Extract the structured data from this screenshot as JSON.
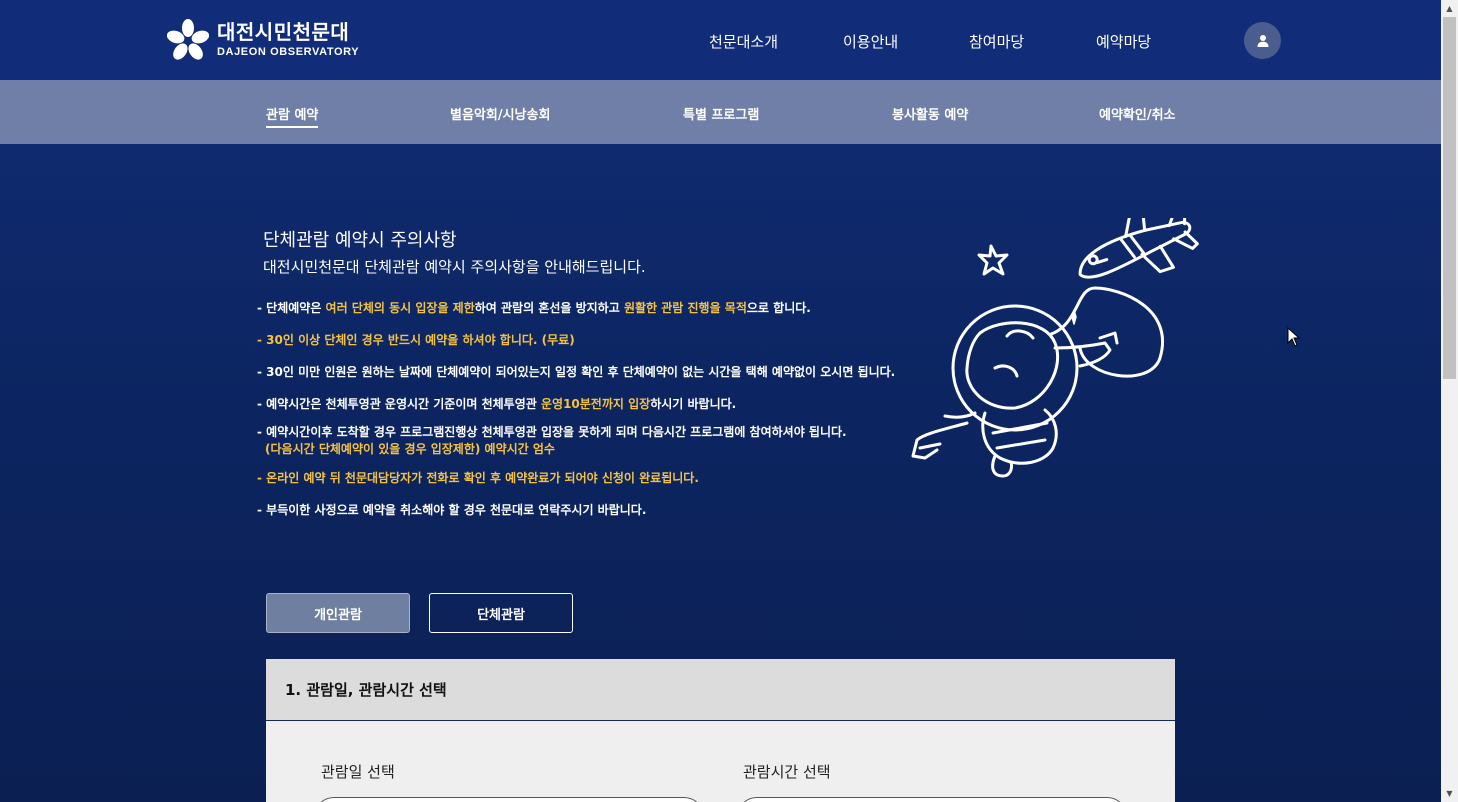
{
  "header": {
    "logo_ko": "대전시민천문대",
    "logo_en": "DAJEON OBSERVATORY",
    "nav": [
      "천문대소개",
      "이용안내",
      "참여마당",
      "예약마당"
    ]
  },
  "subnav": {
    "items": [
      "관람 예약",
      "별음악회/시낭송회",
      "특별 프로그램",
      "봉사활동 예약",
      "예약확인/취소"
    ]
  },
  "notice": {
    "title": "단체관람 예약시 주의사항",
    "subtitle": "대전시민천문대 단체관람 예약시 주의사항을 안내해드립니다.",
    "lines": [
      {
        "parts": [
          "- 단체예약은 ",
          "여러 단체의 동시 입장을 제한",
          "하여 관람의 혼선을 방지하고 ",
          "원활한 관람 진행을 목적",
          "으로 합니다."
        ]
      },
      {
        "text": "- 30인 이상 단체인 경우 반드시 예약을 하셔야 합니다. (무료)"
      },
      {
        "text": "- 30인 미만 인원은 원하는 날짜에 단체예약이 되어있는지 일정 확인 후 단체예약이 없는 시간을 택해 예약없이 오시면 됩니다."
      },
      {
        "parts": [
          "- 예약시간은 천체투영관 운영시간 기준이며 천체투영관 ",
          "운영10분전까지 입장",
          "하시기 바랍니다."
        ]
      },
      {
        "text": "- 예약시간이후 도착할 경우 프로그램진행상 천체투영관 입장을 못하게 되며 다음시간 프로그램에 참여하셔야 됩니다."
      },
      {
        "text": "(다음시간 단체예약이 있을 경우 입장제한) 예약시간 엄수"
      },
      {
        "text": "- 온라인 예약 뒤 천문대담당자가 전화로 확인 후 예약완료가 되어야 신청이 완료됩니다."
      },
      {
        "text": "- 부득이한 사정으로 예약을 취소해야 할 경우 천문대로 연락주시기 바랍니다."
      }
    ]
  },
  "tabs": {
    "individual": "개인관람",
    "group": "단체관람"
  },
  "form": {
    "section_title": "1. 관람일, 관람시간 선택",
    "date_label": "관람일 선택",
    "time_label": "관람시간 선택"
  },
  "colors": {
    "header_bg": "#112c78",
    "subnav_bg": "#6f7fa8",
    "highlight": "#f5c242"
  },
  "icons": {
    "user": "user-icon",
    "logo": "star-flower-logo"
  }
}
